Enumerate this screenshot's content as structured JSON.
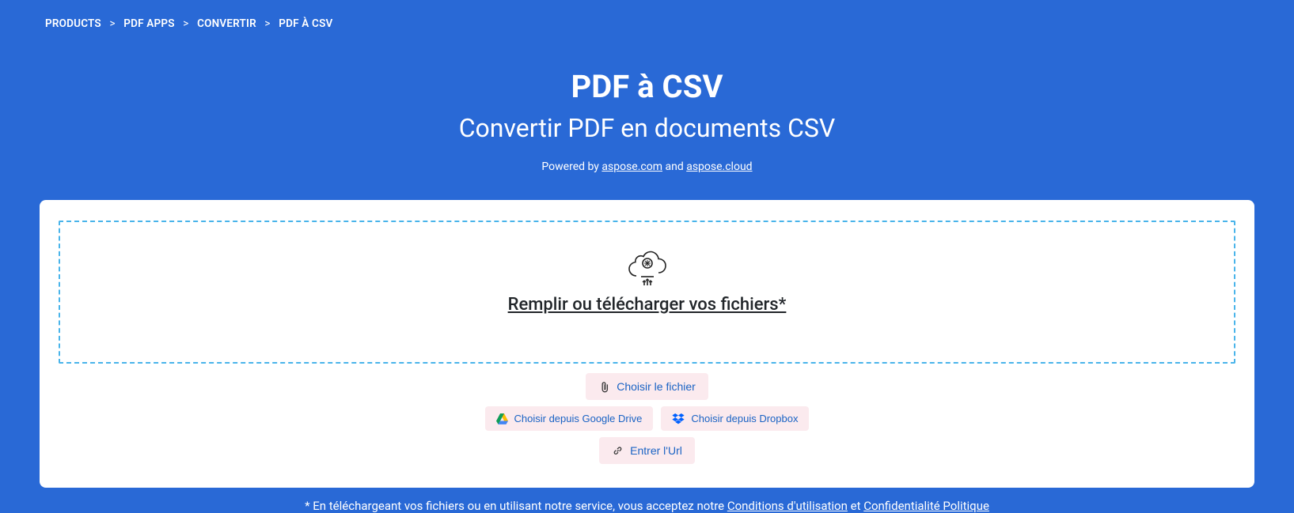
{
  "breadcrumb": {
    "items": [
      {
        "label": "PRODUCTS"
      },
      {
        "label": "PDF APPS"
      },
      {
        "label": "CONVERTIR"
      }
    ],
    "current": "PDF À CSV"
  },
  "hero": {
    "title": "PDF à CSV",
    "subtitle": "Convertir PDF en documents CSV",
    "powered_prefix": "Powered by ",
    "link1": "aspose.com",
    "and": " and ",
    "link2": "aspose.cloud"
  },
  "dropzone": {
    "label": "Remplir ou télécharger vos fichiers*"
  },
  "buttons": {
    "choose_file": "Choisir le fichier",
    "google_drive": "Choisir depuis Google Drive",
    "dropbox": "Choisir depuis Dropbox",
    "enter_url": "Entrer l'Url"
  },
  "disclaimer": {
    "prefix": "* En téléchargeant vos fichiers ou en utilisant notre service, vous acceptez notre ",
    "terms": "Conditions d'utilisation",
    "and": " et ",
    "privacy": "Confidentialité Politique"
  }
}
